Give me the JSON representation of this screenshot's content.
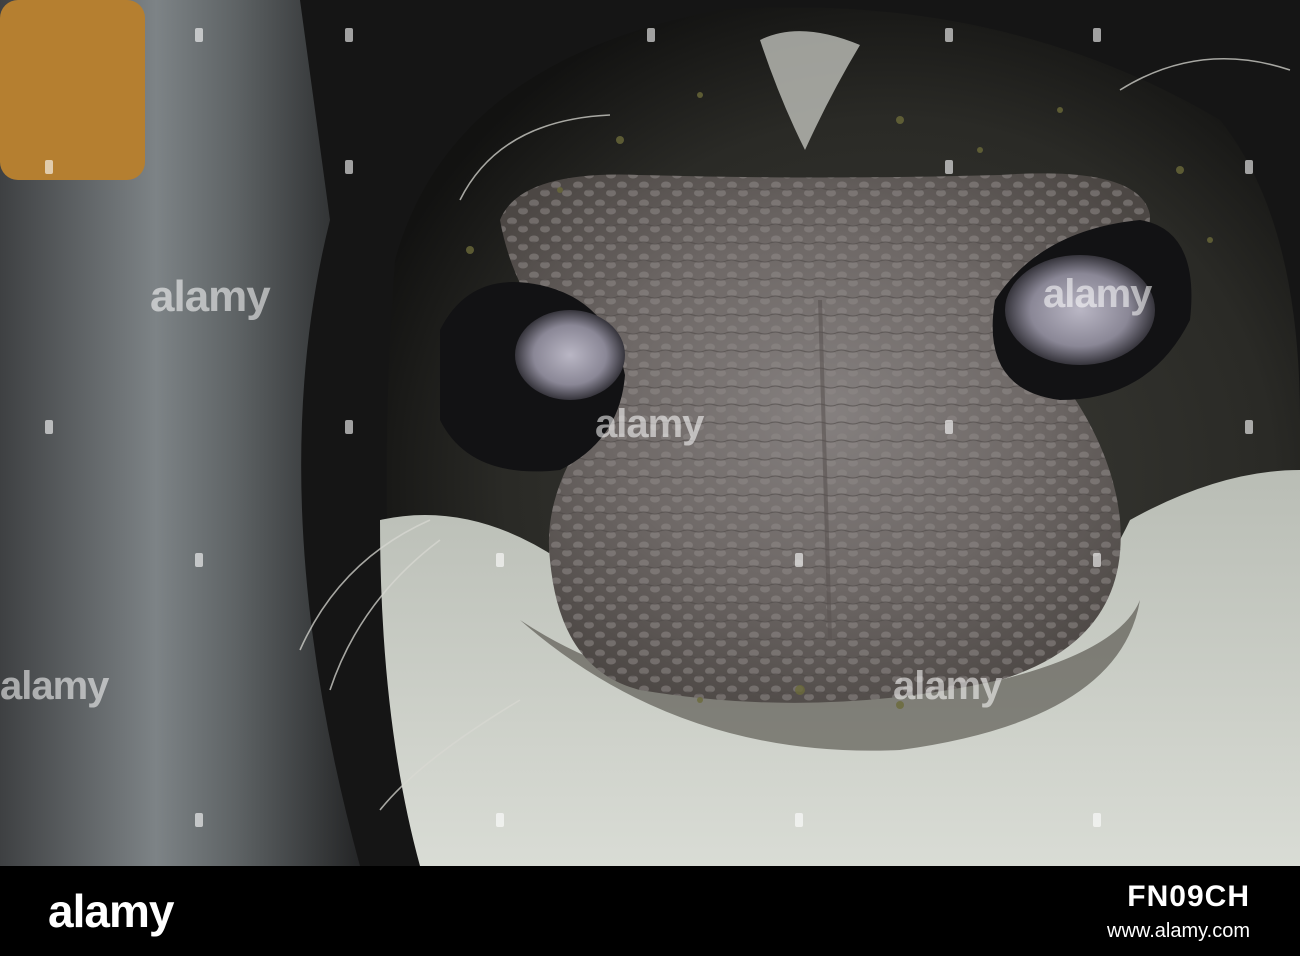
{
  "watermark": {
    "brand": "alamy"
  },
  "footer": {
    "brand": "alamy",
    "image_id": "FN09CH",
    "url": "www.alamy.com"
  },
  "photo": {
    "subject": "close-up-cow-nose"
  }
}
